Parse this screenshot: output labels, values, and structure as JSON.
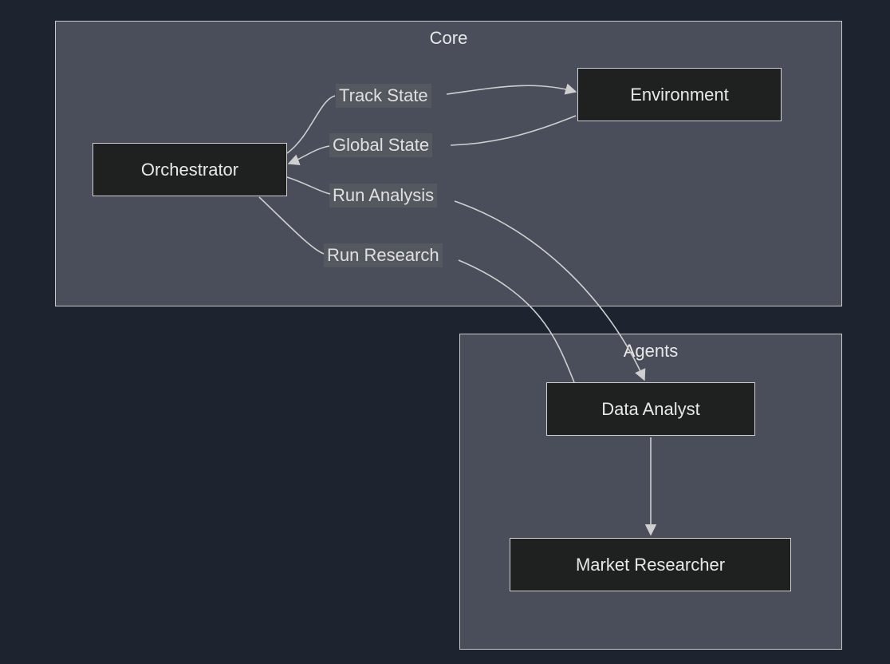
{
  "subgraphs": {
    "core": {
      "title": "Core"
    },
    "agents": {
      "title": "Agents"
    }
  },
  "nodes": {
    "orchestrator": "Orchestrator",
    "environment": "Environment",
    "data_analyst": "Data Analyst",
    "market_researcher": "Market Researcher"
  },
  "edges": {
    "track_state": "Track State",
    "global_state": "Global State",
    "run_analysis": "Run Analysis",
    "run_research": "Run Research"
  }
}
